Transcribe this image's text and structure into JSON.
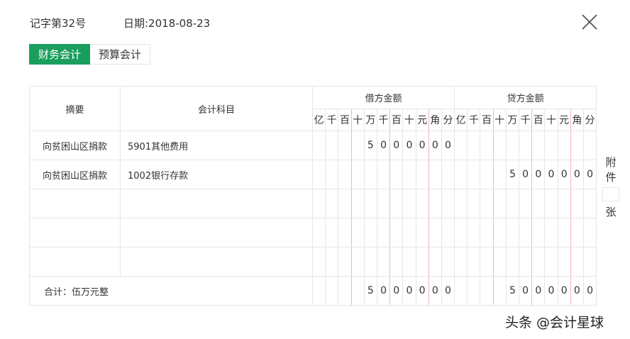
{
  "header": {
    "voucher_no": "记字第32号",
    "date": "日期:2018-08-23",
    "close_icon": "close-icon"
  },
  "tabs": [
    {
      "label": "财务会计",
      "active": true
    },
    {
      "label": "预算会计",
      "active": false
    }
  ],
  "table": {
    "col_summary": "摘要",
    "col_account": "会计科目",
    "debit_header": "借方金额",
    "credit_header": "贷方金额",
    "digit_units": [
      "亿",
      "千",
      "百",
      "十",
      "万",
      "千",
      "百",
      "十",
      "元",
      "角",
      "分"
    ],
    "rows": [
      {
        "summary": "向贫困山区捐款",
        "account": "5901其他费用",
        "debit": [
          "",
          "",
          "",
          "",
          "5",
          "0",
          "0",
          "0",
          "0",
          "0",
          "0"
        ],
        "credit": [
          "",
          "",
          "",
          "",
          "",
          "",
          "",
          "",
          "",
          "",
          ""
        ]
      },
      {
        "summary": "向贫困山区捐款",
        "account": "1002银行存款",
        "debit": [
          "",
          "",
          "",
          "",
          "",
          "",
          "",
          "",
          "",
          "",
          ""
        ],
        "credit": [
          "",
          "",
          "",
          "",
          "5",
          "0",
          "0",
          "0",
          "0",
          "0",
          "0"
        ]
      },
      {
        "summary": "",
        "account": "",
        "debit": [
          "",
          "",
          "",
          "",
          "",
          "",
          "",
          "",
          "",
          "",
          ""
        ],
        "credit": [
          "",
          "",
          "",
          "",
          "",
          "",
          "",
          "",
          "",
          "",
          ""
        ]
      },
      {
        "summary": "",
        "account": "",
        "debit": [
          "",
          "",
          "",
          "",
          "",
          "",
          "",
          "",
          "",
          "",
          ""
        ],
        "credit": [
          "",
          "",
          "",
          "",
          "",
          "",
          "",
          "",
          "",
          "",
          ""
        ]
      },
      {
        "summary": "",
        "account": "",
        "debit": [
          "",
          "",
          "",
          "",
          "",
          "",
          "",
          "",
          "",
          "",
          ""
        ],
        "credit": [
          "",
          "",
          "",
          "",
          "",
          "",
          "",
          "",
          "",
          "",
          ""
        ]
      }
    ],
    "total": {
      "label": "合计：伍万元整",
      "debit": [
        "",
        "",
        "",
        "",
        "5",
        "0",
        "0",
        "0",
        "0",
        "0",
        "0"
      ],
      "credit": [
        "",
        "",
        "",
        "",
        "5",
        "0",
        "0",
        "0",
        "0",
        "0",
        "0"
      ]
    }
  },
  "attachment": {
    "line1": "附",
    "line2": "件",
    "count": "",
    "unit": "张"
  },
  "watermark": "头条 @会计星球",
  "colors": {
    "accent": "#1a9e5e",
    "thousands_separator": "#a9d3ef",
    "yuan_separator": "#f0b6b6"
  }
}
